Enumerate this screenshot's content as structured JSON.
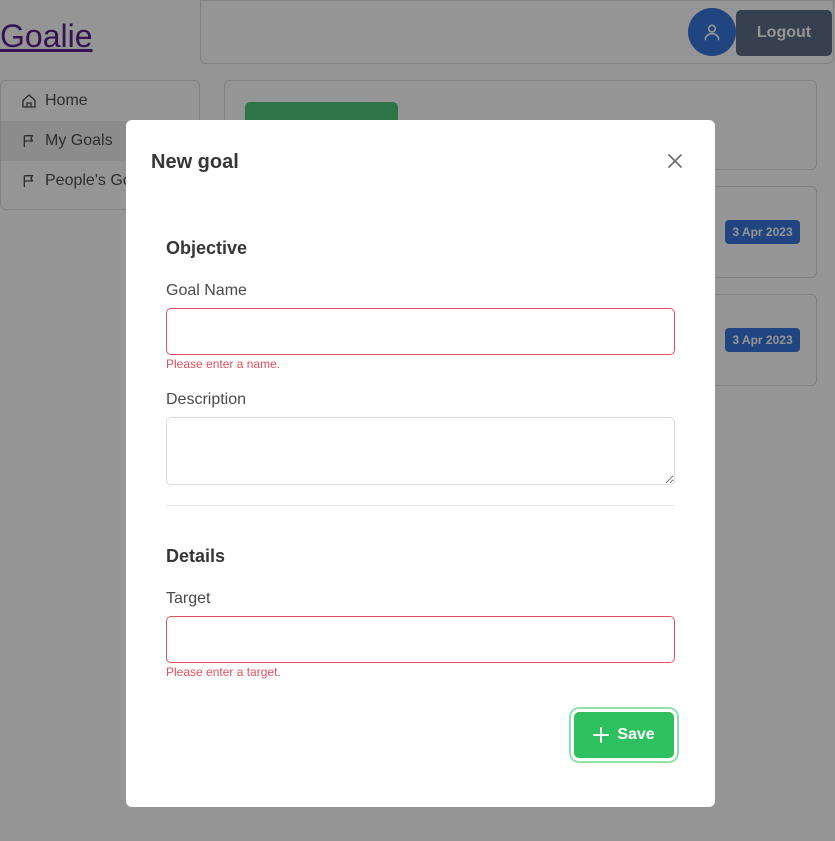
{
  "app": {
    "brand": "Goalie"
  },
  "header": {
    "logout_label": "Logout",
    "avatar_icon": "user-icon"
  },
  "sidebar": {
    "items": [
      {
        "label": "Home",
        "icon": "home-icon"
      },
      {
        "label": "My Goals",
        "icon": "flag-icon",
        "active": true
      },
      {
        "label": "People's Goals",
        "icon": "flag-icon"
      }
    ]
  },
  "goal_list": {
    "dates": [
      "3 Apr 2023",
      "3 Apr 2023"
    ]
  },
  "modal": {
    "title": "New goal",
    "close_icon": "close-icon",
    "objective": {
      "heading": "Objective",
      "name_label": "Goal Name",
      "name_value": "",
      "name_error": "Please enter a name.",
      "description_label": "Description",
      "description_value": ""
    },
    "details": {
      "heading": "Details",
      "target_label": "Target",
      "target_value": "",
      "target_error": "Please enter a target."
    },
    "save_label": "Save",
    "save_icon": "plus-icon"
  },
  "colors": {
    "accent_green": "#2ec05e",
    "link_blue": "#3273dc",
    "danger": "#e0505e",
    "brand_link": "#551a8b"
  }
}
